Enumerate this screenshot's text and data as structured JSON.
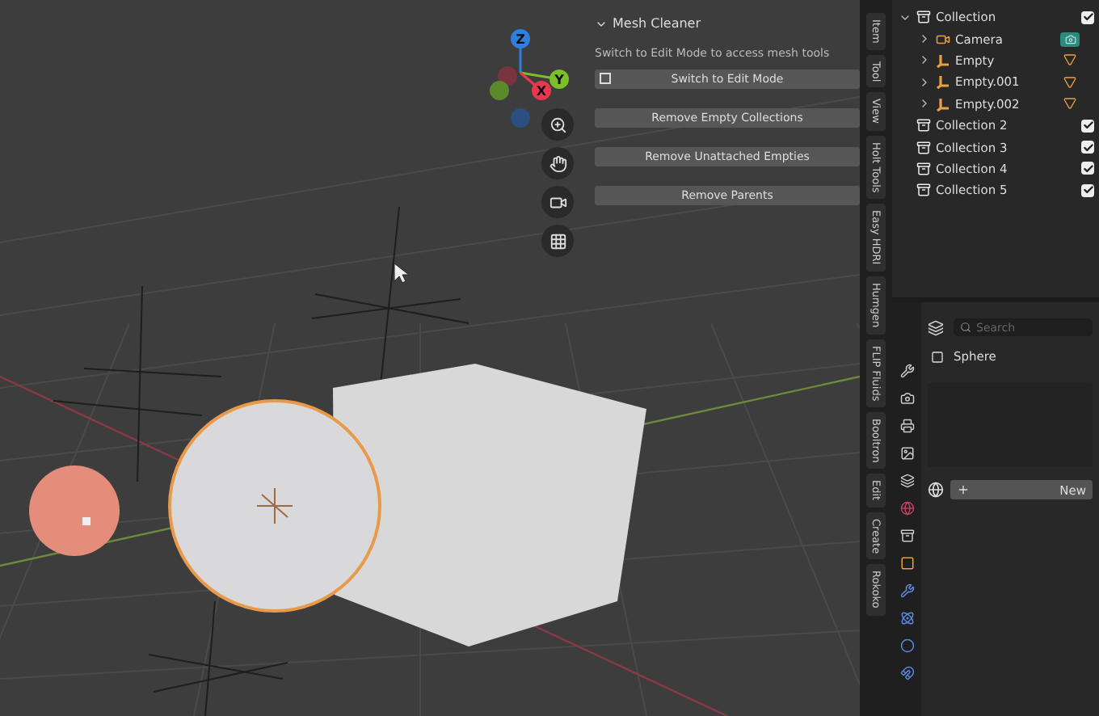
{
  "viewport": {
    "gizmo": {
      "axes": [
        {
          "label": "Z",
          "color": "#2f7fe0"
        },
        {
          "label": "Y",
          "color": "#7bbf2a"
        },
        {
          "label": "X",
          "color": "#e8384f"
        }
      ]
    },
    "addon_panel": {
      "title": "Mesh Cleaner",
      "expanded": true,
      "hint": "Switch to Edit Mode to access mesh tools",
      "buttons": [
        {
          "label": "Switch to Edit Mode",
          "kind": "icon"
        },
        {
          "label": "Remove Empty Collections",
          "kind": "plain"
        },
        {
          "label": "Remove Unattached Empties",
          "kind": "plain"
        },
        {
          "label": "Remove Parents",
          "kind": "plain"
        }
      ]
    }
  },
  "sidebar_tabs": [
    "Item",
    "Tool",
    "View",
    "Holt Tools",
    "Easy HDRI",
    "Humgen",
    "FLIP Fluids",
    "Booltron",
    "Edit",
    "Create",
    "Rokoko"
  ],
  "outliner": {
    "items": [
      {
        "label": "Collection",
        "kind": "collection",
        "expanded": true,
        "checked": true,
        "children": [
          {
            "label": "Camera",
            "kind": "camera",
            "expanded": false
          },
          {
            "label": "Empty",
            "kind": "empty",
            "expanded": false
          },
          {
            "label": "Empty.001",
            "kind": "empty",
            "expanded": false
          },
          {
            "label": "Empty.002",
            "kind": "empty",
            "expanded": false
          }
        ]
      },
      {
        "label": "Collection 2",
        "kind": "collection",
        "checked": true
      },
      {
        "label": "Collection 3",
        "kind": "collection",
        "checked": true
      },
      {
        "label": "Collection 4",
        "kind": "collection",
        "checked": true
      },
      {
        "label": "Collection 5",
        "kind": "collection",
        "checked": true
      }
    ]
  },
  "properties": {
    "search": {
      "placeholder": "Search"
    },
    "object_name": "Sphere",
    "new_button": "New"
  }
}
